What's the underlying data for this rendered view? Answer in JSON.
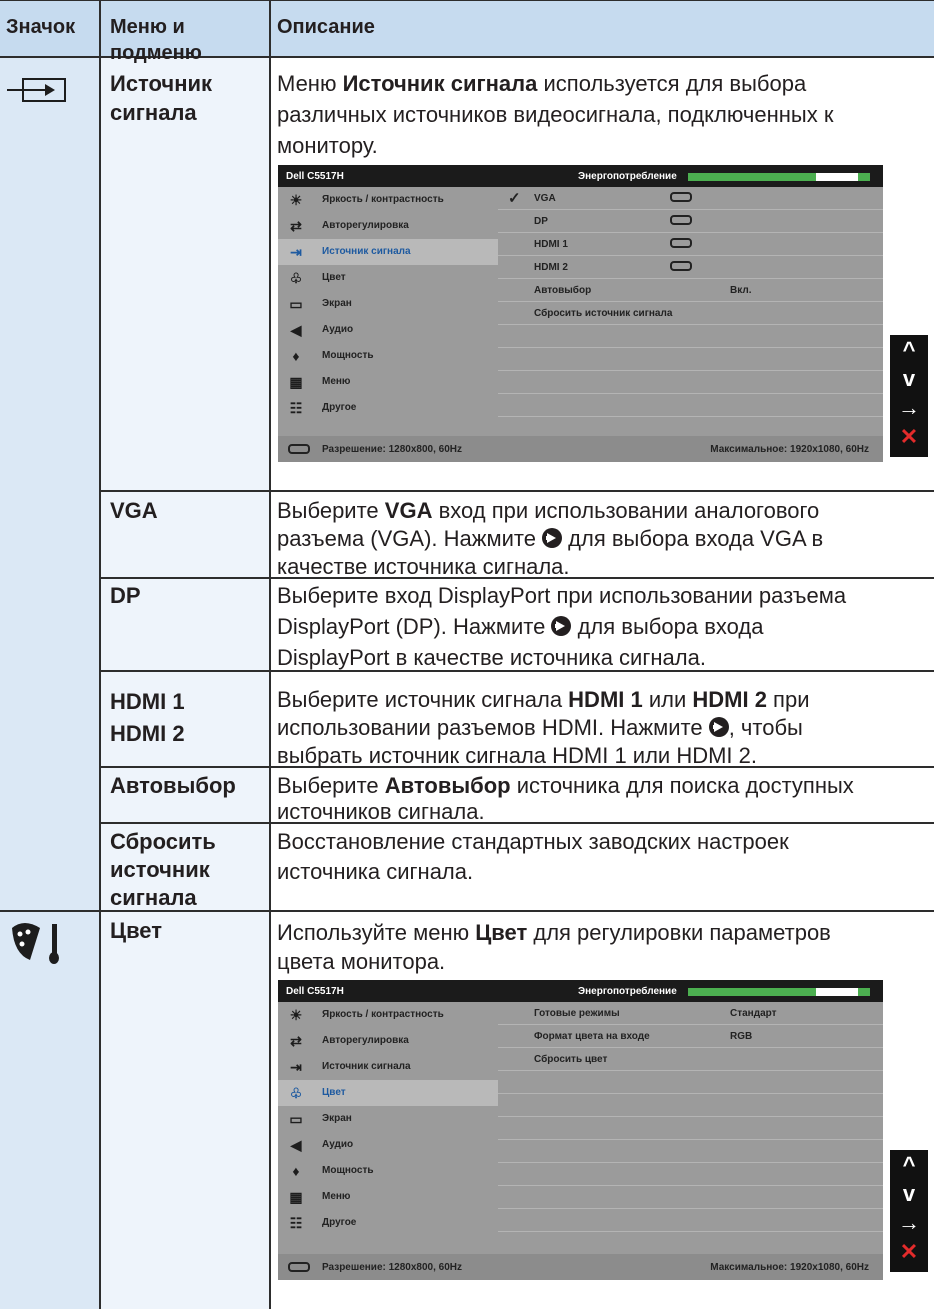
{
  "header": {
    "icon": "Значок",
    "menu_l1": "Меню и",
    "menu_l2": "подменю",
    "desc": "Описание"
  },
  "rows": {
    "source": {
      "name_l1": "Источник",
      "name_l2": "сигнала",
      "d1a": "Меню ",
      "d1b": "Источник сигнала",
      "d1c": " используется для выбора",
      "d2": "различных источников видеосигнала, подключенных к",
      "d3": "монитору."
    },
    "vga": {
      "name": "VGA",
      "d1a": "Выберите ",
      "d1b": "VGA",
      "d1c": " вход при использовании аналогового",
      "d2a": "разъема (VGA). Нажмите ",
      "d2b": " для выбора входа VGA в",
      "d3": "качестве источника сигнала."
    },
    "dp": {
      "name": "DP",
      "d1": "Выберите вход DisplayPort при использовании разъема",
      "d2a": "DisplayPort (DP). Нажмите ",
      "d2b": " для выбора входа",
      "d3": "DisplayPort в качестве источника сигнала."
    },
    "hdmi": {
      "name1": "HDMI 1",
      "name2": "HDMI 2",
      "d1a": "Выберите источник сигнала ",
      "d1b": "HDMI 1",
      "d1c": " или ",
      "d1d": "HDMI 2",
      "d1e": " при",
      "d2a": "использовании разъемов HDMI. Нажмите ",
      "d2b": ", чтобы",
      "d3": "выбрать источник сигнала HDMI 1 или HDMI 2."
    },
    "auto": {
      "name": "Автовыбор",
      "d1a": "Выберите ",
      "d1b": "Автовыбор",
      "d1c": " источника для поиска доступных",
      "d2": "источников сигнала."
    },
    "reset": {
      "name_l1": "Сбросить",
      "name_l2": "источник",
      "name_l3": "сигнала",
      "d1": "Восстановление стандартных заводских настроек",
      "d2": "источника сигнала."
    },
    "color": {
      "name": "Цвет",
      "d1a": "Используйте меню ",
      "d1b": "Цвет",
      "d1c": " для регулировки параметров",
      "d2": "цвета монитора."
    }
  },
  "osd": {
    "model": "Dell C5517H",
    "energy": "Энергопотребление",
    "menu": [
      "Яркость / контрастность",
      "Авторегулировка",
      "Источник сигнала",
      "Цвет",
      "Экран",
      "Аудио",
      "Мощность",
      "Меню",
      "Другое"
    ],
    "resolution": "Разрешение: 1280x800, 60Hz",
    "max": "Максимальное: 1920x1080, 60Hz",
    "source_items": [
      "VGA",
      "DP",
      "HDMI 1",
      "HDMI 2",
      "Автовыбор",
      "Сбросить  источник сигнала"
    ],
    "auto_value": "Вкл.",
    "color_items": [
      "Готовые режимы",
      "Формат цвета на входе",
      "Сбросить цвет"
    ],
    "color_values": [
      "Стандарт",
      "RGB"
    ]
  },
  "nav": {
    "up": "^",
    "down": "v",
    "enter": "→",
    "exit": "✕"
  }
}
